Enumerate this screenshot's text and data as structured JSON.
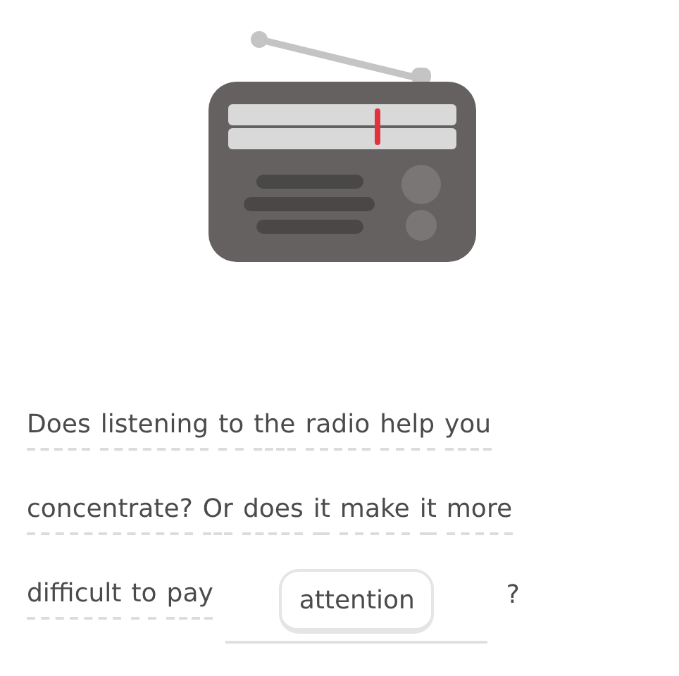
{
  "illustration": {
    "kind": "radio"
  },
  "sentence": [
    {
      "kind": "word",
      "text": "Does"
    },
    {
      "kind": "word",
      "text": "listening"
    },
    {
      "kind": "word",
      "text": "to"
    },
    {
      "kind": "word",
      "text": "the"
    },
    {
      "kind": "word",
      "text": "radio"
    },
    {
      "kind": "word",
      "text": "help"
    },
    {
      "kind": "word",
      "text": "you"
    },
    {
      "kind": "word",
      "text": "concentrate?"
    },
    {
      "kind": "word",
      "text": "Or"
    },
    {
      "kind": "word",
      "text": "does"
    },
    {
      "kind": "word",
      "text": "it"
    },
    {
      "kind": "word",
      "text": "make"
    },
    {
      "kind": "word",
      "text": "it"
    },
    {
      "kind": "word",
      "text": "more"
    },
    {
      "kind": "word",
      "text": "difficult"
    },
    {
      "kind": "word",
      "text": "to"
    },
    {
      "kind": "word",
      "text": "pay"
    },
    {
      "kind": "blank",
      "answer": "attention"
    },
    {
      "kind": "punct",
      "text": "?"
    }
  ]
}
